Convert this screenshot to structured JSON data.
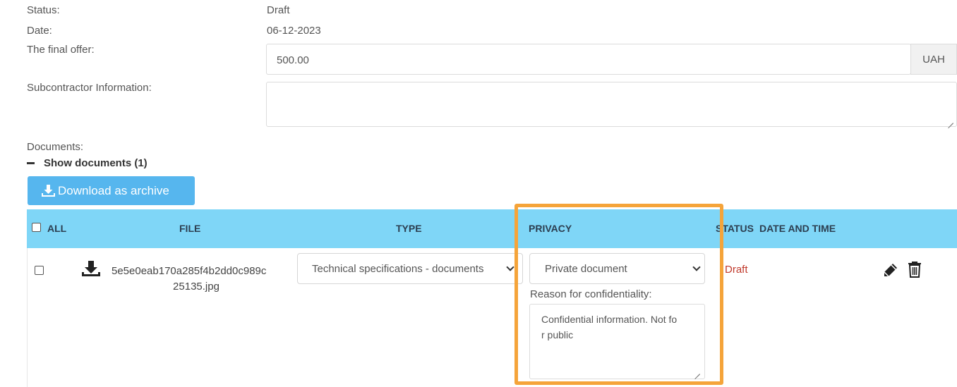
{
  "fields": {
    "status_label": "Status:",
    "status_value": "Draft",
    "date_label": "Date:",
    "date_value": "06-12-2023",
    "final_offer_label": "The final offer:",
    "final_offer_value": "500.00",
    "currency": "UAH",
    "subcontractor_label": "Subcontractor Information:",
    "subcontractor_value": ""
  },
  "documents": {
    "label": "Documents:",
    "toggle_label": "Show documents (1)",
    "download_button": "Download as archive",
    "columns": {
      "all": "ALL",
      "file": "FILE",
      "type": "TYPE",
      "privacy": "PRIVACY",
      "status": "STATUS",
      "date_time": "DATE AND TIME"
    },
    "rows": [
      {
        "file_line1": "5e5e0eab170a285f4b2dd0c989c",
        "file_line2": "25135.jpg",
        "type": "Technical specifications - documents",
        "privacy": "Private document",
        "reason_label": "Reason for confidentiality:",
        "reason_line1": "Confidential information. Not fo",
        "reason_line2": "r public",
        "status": "Draft",
        "status_color": "#c0392b",
        "date_time": ""
      }
    ]
  },
  "colors": {
    "header_bg": "#7fd6f7",
    "button_bg": "#56b6ee",
    "highlight": "#f5a43a"
  }
}
